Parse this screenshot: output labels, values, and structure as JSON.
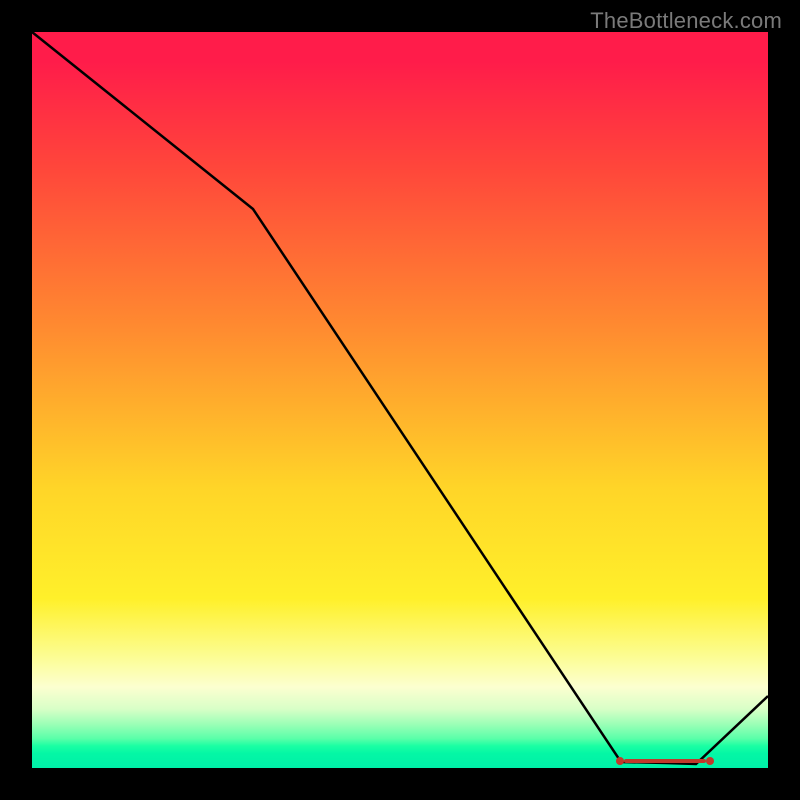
{
  "watermark": "TheBottleneck.com",
  "chart_data": {
    "type": "line",
    "title": "",
    "xlabel": "",
    "ylabel": "",
    "xlim": [
      0,
      100
    ],
    "ylim": [
      0,
      100
    ],
    "x": [
      0,
      30,
      80,
      90,
      100
    ],
    "values": [
      100,
      76,
      1,
      0.5,
      10
    ],
    "markers": {
      "x_start": 80,
      "x_end": 92,
      "y": 1
    },
    "background_gradient": {
      "top": "#ff1c4a",
      "mid_top": "#ff8a30",
      "mid": "#ffd528",
      "mid_bottom": "#fcfd95",
      "bottom": "#00f0a8"
    }
  }
}
